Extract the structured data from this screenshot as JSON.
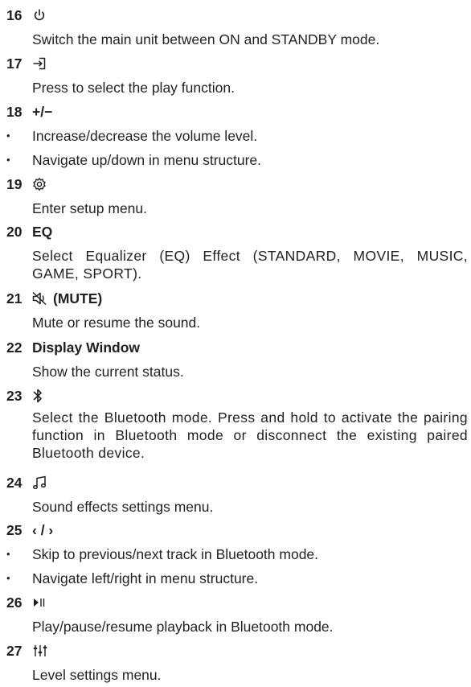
{
  "entries": [
    {
      "number": "16",
      "icon": "power-icon",
      "desc": [
        "Switch the main unit between ON and STANDBY mode."
      ]
    },
    {
      "number": "17",
      "icon": "input-source-icon",
      "desc": [
        "Press to select the play function."
      ]
    },
    {
      "number": "18",
      "title": "+/−",
      "bullets": [
        "Increase/decrease the volume level.",
        "Navigate up/down in menu structure."
      ]
    },
    {
      "number": "19",
      "icon": "settings-gear-icon",
      "desc": [
        "Enter setup menu."
      ]
    },
    {
      "number": "20",
      "title": "EQ",
      "desc": [
        "Select Equalizer (EQ) Effect (STANDARD, MOVIE, MUSIC, GAME, SPORT)."
      ]
    },
    {
      "number": "21",
      "icon": "mute-speaker-icon",
      "title": "(MUTE)",
      "desc": [
        "Mute or resume the sound."
      ]
    },
    {
      "number": "22",
      "title": "Display Window",
      "desc": [
        "Show the current status."
      ]
    },
    {
      "number": "23",
      "icon": "bluetooth-icon",
      "desc": [
        "Select the Bluetooth mode. Press and hold to activate the pairing function in Bluetooth mode or disconnect the existing paired Bluetooth device."
      ]
    },
    {
      "number": "24",
      "icon": "music-note-icon",
      "desc": [
        "Sound effects settings menu."
      ]
    },
    {
      "number": "25",
      "title": "‹ / ›",
      "bullets": [
        "Skip to previous/next track in Bluetooth mode.",
        "Navigate left/right in menu structure."
      ]
    },
    {
      "number": "26",
      "icon": "play-pause-icon",
      "desc": [
        "Play/pause/resume playback in Bluetooth mode."
      ]
    },
    {
      "number": "27",
      "icon": "level-sliders-icon",
      "desc": [
        "Level settings menu."
      ]
    }
  ],
  "bullet_mark": "•"
}
